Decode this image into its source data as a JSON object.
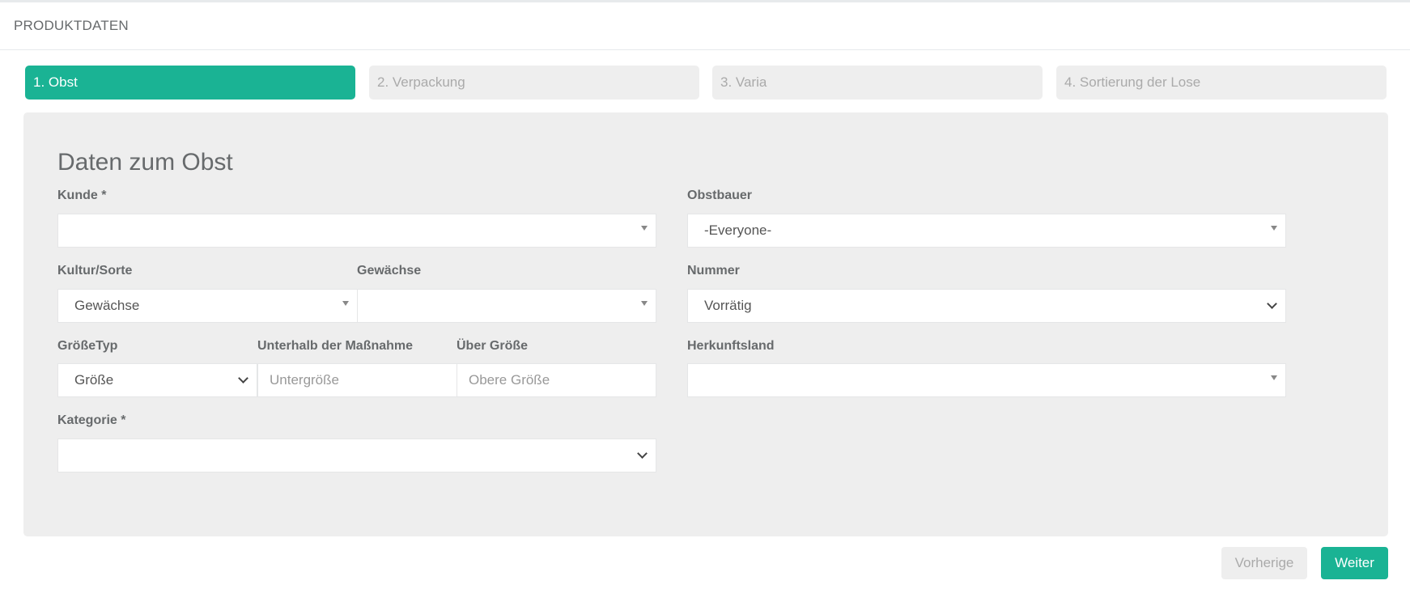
{
  "panel": {
    "title": "PRODUKTDATEN"
  },
  "steps": [
    {
      "label": "1. Obst",
      "active": true
    },
    {
      "label": "2. Verpackung",
      "active": false
    },
    {
      "label": "3. Varia",
      "active": false
    },
    {
      "label": "4. Sortierung der Lose",
      "active": false
    }
  ],
  "form": {
    "title": "Daten zum Obst",
    "kunde": {
      "label": "Kunde *",
      "value": ""
    },
    "obstbauer": {
      "label": "Obstbauer",
      "value": "-Everyone-"
    },
    "kultur": {
      "label": "Kultur/Sorte",
      "value": "Gewächse"
    },
    "gewaechse": {
      "label": "Gewächse",
      "value": ""
    },
    "nummer": {
      "label": "Nummer",
      "value": "Vorrätig"
    },
    "groessetyp": {
      "label": "GrößeTyp",
      "value": "Größe"
    },
    "untergroesse": {
      "label": "Unterhalb der Maßnahme",
      "placeholder": "Untergröße"
    },
    "obergroesse": {
      "label": "Über Größe",
      "placeholder": "Obere Größe"
    },
    "herkunftsland": {
      "label": "Herkunftsland",
      "value": ""
    },
    "kategorie": {
      "label": "Kategorie *",
      "value": ""
    }
  },
  "buttons": {
    "previous": "Vorherige",
    "next": "Weiter"
  },
  "colors": {
    "accent": "#1ab394",
    "panel_bg": "#eeeeee",
    "text": "#676a6c"
  }
}
